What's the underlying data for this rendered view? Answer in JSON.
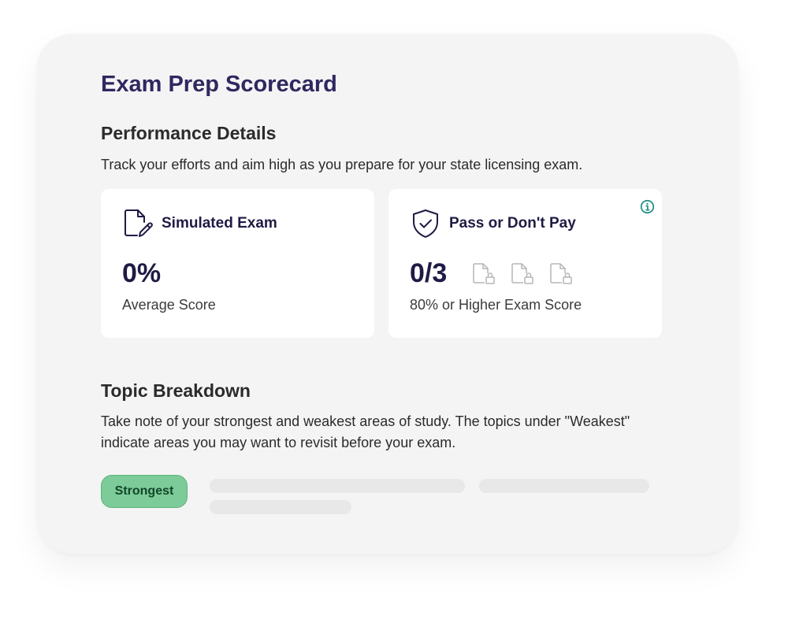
{
  "scorecard": {
    "title": "Exam Prep Scorecard"
  },
  "performance": {
    "heading": "Performance Details",
    "description": "Track your efforts and aim high as you prepare for your state licensing exam.",
    "simulated_exam": {
      "icon": "document-edit-icon",
      "title": "Simulated Exam",
      "value": "0%",
      "label": "Average Score"
    },
    "pass_or_dont_pay": {
      "icon": "shield-check-icon",
      "title": "Pass or Don't Pay",
      "value": "0/3",
      "label": "80% or Higher Exam Score",
      "info_icon": "info-icon",
      "locked_exam_icons": [
        "locked-document-icon",
        "locked-document-icon",
        "locked-document-icon"
      ]
    }
  },
  "topics": {
    "heading": "Topic Breakdown",
    "description": "Take note of your strongest and weakest areas of study. The topics under \"Weakest\" indicate areas you may want to revisit before your exam.",
    "badge": "Strongest"
  },
  "colors": {
    "title": "#2f2860",
    "card_text": "#1f1b45",
    "badge_bg": "#7ccb98",
    "badge_text": "#13462a",
    "info_accent": "#1b8f80",
    "skeleton": "#e8e8e8",
    "panel_bg": "#f4f4f4"
  }
}
